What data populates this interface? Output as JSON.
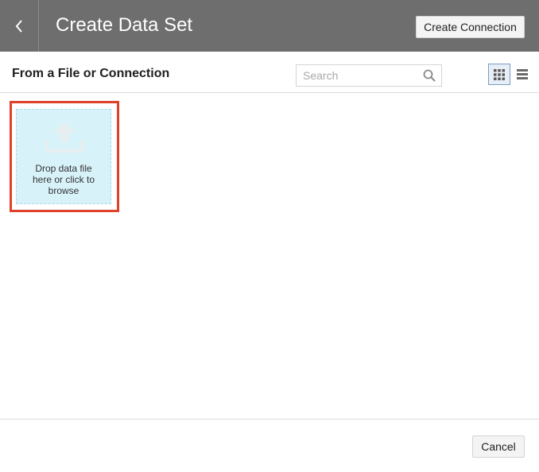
{
  "header": {
    "title": "Create Data Set",
    "create_connection_label": "Create Connection",
    "back_icon": "chevron-left-icon"
  },
  "toolbar": {
    "section_title": "From a File or Connection",
    "search_placeholder": "Search",
    "search_value": "",
    "view_mode": "grid",
    "grid_view_icon": "grid-view-icon",
    "list_view_icon": "list-view-icon"
  },
  "dropzone": {
    "text": "Drop data file\nhere or click to\nbrowse",
    "icon": "upload-icon"
  },
  "footer": {
    "cancel_label": "Cancel"
  },
  "colors": {
    "header_bg": "#6e6e6e",
    "dropzone_bg": "#d8f2fa",
    "highlight_border": "#e0412a"
  }
}
